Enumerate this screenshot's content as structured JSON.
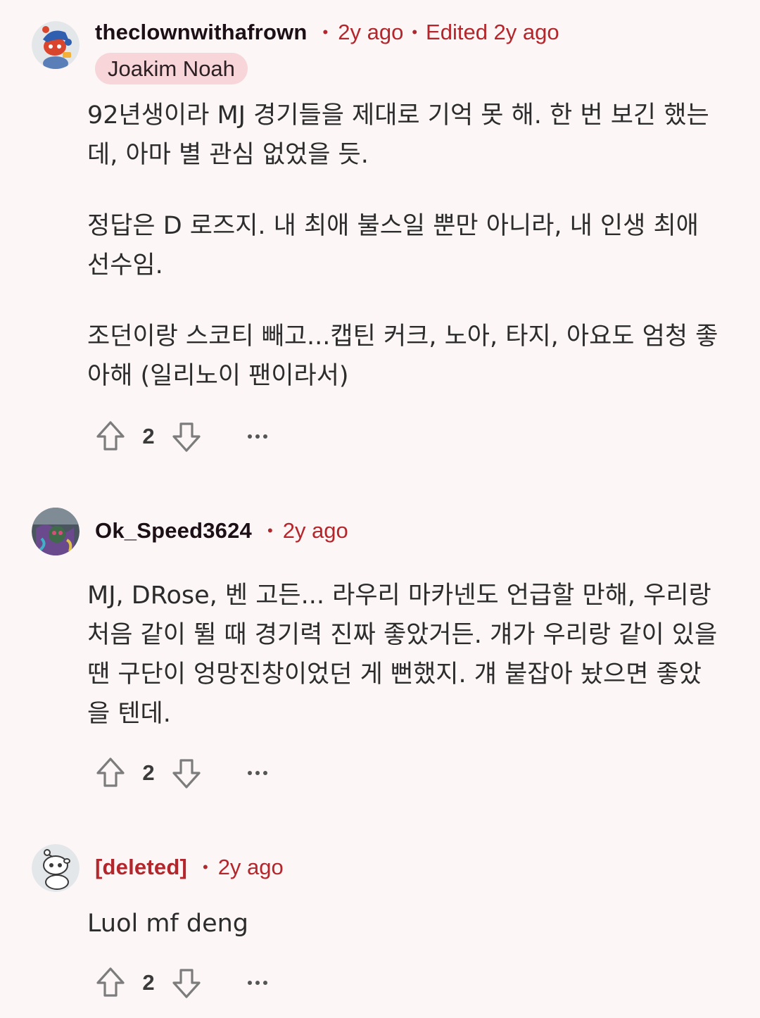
{
  "comments": [
    {
      "username": "theclownwithafrown",
      "time": "2y ago",
      "edited": "Edited 2y ago",
      "flair": "Joakim Noah",
      "paragraphs": [
        "92년생이라 MJ 경기들을 제대로 기억 못 해. 한 번 보긴 했는데, 아마 별 관심 없었을 듯.",
        "정답은 D 로즈지. 내 최애 불스일 뿐만 아니라, 내 인생 최애 선수임.",
        "조던이랑 스코티 빼고...캡틴 커크, 노아, 타지, 아요도 엄청 좋아해 (일리노이 팬이라서)"
      ],
      "score": "2",
      "avatar_icon": "snoo-avatar-red-blue"
    },
    {
      "username": "Ok_Speed3624",
      "time": "2y ago",
      "paragraphs": [
        "MJ, DRose, 벤 고든... 라우리 마카넨도 언급할 만해, 우리랑 처음 같이 뛸 때 경기력 진짜 좋았거든. 걔가 우리랑 같이 있을 땐 구단이 엉망진창이었던 게 뻔했지. 걔 붙잡아 놨으면 좋았을 텐데."
      ],
      "score": "2",
      "avatar_icon": "mural-photo-avatar"
    },
    {
      "username": "[deleted]",
      "time": "2y ago",
      "paragraphs": [
        "Luol mf deng"
      ],
      "score": "2",
      "avatar_icon": "deleted-snoo-avatar"
    }
  ],
  "icons": {
    "upvote": "upvote-arrow-icon",
    "downvote": "downvote-arrow-icon",
    "more": "more-options-icon"
  },
  "colors": {
    "background": "#fcf6f6",
    "accent": "#b3262b",
    "flair_bg": "#f7d5d8"
  }
}
